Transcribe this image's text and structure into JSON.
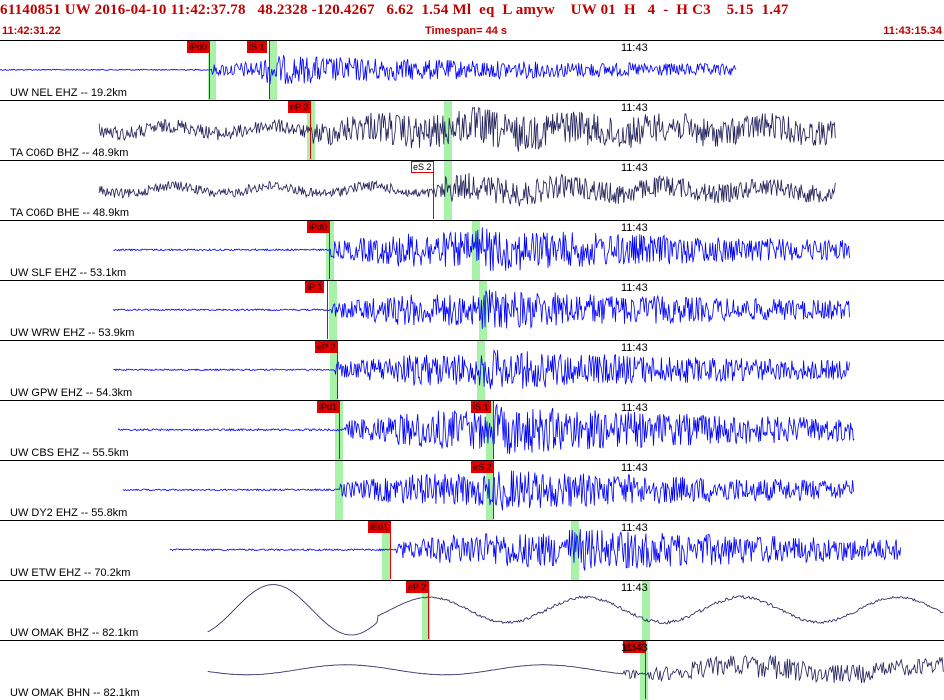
{
  "header": {
    "title": "61140851 UW 2016-04-10 11:42:37.78   48.2328 -120.4267   6.62  1.54 Ml  eq  L amyw    UW 01  H   4  -  H C3    5.15  1.47",
    "start_time": "11:42:31.22",
    "timespan": "Timespan=  44 s",
    "end_time": "11:43:15.34"
  },
  "colors": {
    "blue": "#0000ff",
    "navy": "#20205a",
    "red": "#e00000",
    "green": "#99f099"
  },
  "tick_label": "11:43",
  "panels": [
    {
      "label": "UW NEL EHZ -- 19.2km",
      "color": "#0000ff",
      "start": 0.0,
      "end": 0.78,
      "amp": 0.22,
      "onset": 0.225,
      "burst": 0.28,
      "wave": "seis",
      "picks": [
        {
          "text": "iPd0",
          "x": 0.198,
          "style": "filled"
        },
        {
          "text": "iS 1",
          "x": 0.262,
          "style": "filled"
        }
      ],
      "greens": [
        0.22,
        0.285
      ]
    },
    {
      "label": "TA C06D BHZ -- 48.9km",
      "color": "#20205a",
      "start": 0.105,
      "end": 0.885,
      "amp": 0.35,
      "onset": 0.33,
      "burst": 0.5,
      "wave": "noise",
      "picks": [
        {
          "text": "eP 2",
          "x": 0.305,
          "style": "filled"
        }
      ],
      "greens": [
        0.325,
        0.47
      ]
    },
    {
      "label": "TA C06D BHE -- 48.9km",
      "color": "#20205a",
      "start": 0.105,
      "end": 0.885,
      "amp": 0.25,
      "onset": 0.46,
      "burst": 0.47,
      "wave": "noise",
      "picks": [
        {
          "text": "eS 2",
          "x": 0.435,
          "style": "outline"
        }
      ],
      "greens": [
        0.47
      ]
    },
    {
      "label": "UW SLF EHZ -- 53.1km",
      "color": "#0000ff",
      "start": 0.12,
      "end": 0.9,
      "amp": 0.33,
      "onset": 0.35,
      "burst": 0.5,
      "wave": "seis",
      "picks": [
        {
          "text": "iPd0",
          "x": 0.325,
          "style": "filled"
        }
      ],
      "greens": [
        0.345,
        0.5
      ]
    },
    {
      "label": "UW WRW EHZ -- 53.9km",
      "color": "#0000ff",
      "start": 0.12,
      "end": 0.9,
      "amp": 0.3,
      "onset": 0.35,
      "burst": 0.51,
      "wave": "seis",
      "picks": [
        {
          "text": "iP 1",
          "x": 0.323,
          "style": "filled"
        }
      ],
      "greens": [
        0.348,
        0.507
      ]
    },
    {
      "label": "UW GPW EHZ -- 54.3km",
      "color": "#0000ff",
      "start": 0.12,
      "end": 0.9,
      "amp": 0.3,
      "onset": 0.355,
      "burst": 0.51,
      "wave": "seis",
      "picks": [
        {
          "text": "eP 2",
          "x": 0.334,
          "style": "filled"
        }
      ],
      "greens": [
        0.35,
        0.505
      ]
    },
    {
      "label": "UW CBS EHZ -- 55.5km",
      "color": "#0000ff",
      "start": 0.125,
      "end": 0.905,
      "amp": 0.36,
      "onset": 0.365,
      "burst": 0.525,
      "wave": "seis",
      "picks": [
        {
          "text": "iPd1",
          "x": 0.336,
          "style": "filled"
        },
        {
          "text": "iS 1",
          "x": 0.499,
          "style": "filled"
        }
      ],
      "greens": [
        0.355,
        0.515
      ]
    },
    {
      "label": "UW DY2 EHZ -- 55.8km",
      "color": "#0000ff",
      "start": 0.13,
      "end": 0.905,
      "amp": 0.3,
      "onset": 0.36,
      "burst": 0.525,
      "wave": "seis",
      "picks": [
        {
          "text": "eS 2",
          "x": 0.499,
          "style": "filled"
        }
      ],
      "greens": [
        0.355,
        0.515
      ]
    },
    {
      "label": "UW ETW EHZ -- 70.2km",
      "color": "#0000ff",
      "start": 0.18,
      "end": 0.955,
      "amp": 0.32,
      "onset": 0.42,
      "burst": 0.6,
      "wave": "seis",
      "picks": [
        {
          "text": "iEd1",
          "x": 0.39,
          "style": "filled"
        }
      ],
      "greens": [
        0.405,
        0.605
      ]
    },
    {
      "label": "UW OMAK BHZ -- 82.1km",
      "color": "#20205a",
      "start": 0.22,
      "end": 1.0,
      "amp": 0.4,
      "onset": 0.45,
      "burst": 0.68,
      "wave": "long",
      "picks": [
        {
          "text": "eP 2",
          "x": 0.43,
          "style": "filled"
        }
      ],
      "greens": [
        0.447,
        0.68
      ]
    },
    {
      "label": "UW OMAK BHN -- 82.1km",
      "color": "#20205a",
      "start": 0.22,
      "end": 1.0,
      "amp": 0.3,
      "onset": 0.66,
      "burst": 0.8,
      "wave": "long2",
      "picks": [
        {
          "text": "eS 2",
          "x": 0.66,
          "style": "filled"
        }
      ],
      "greens": [
        0.678
      ]
    }
  ]
}
